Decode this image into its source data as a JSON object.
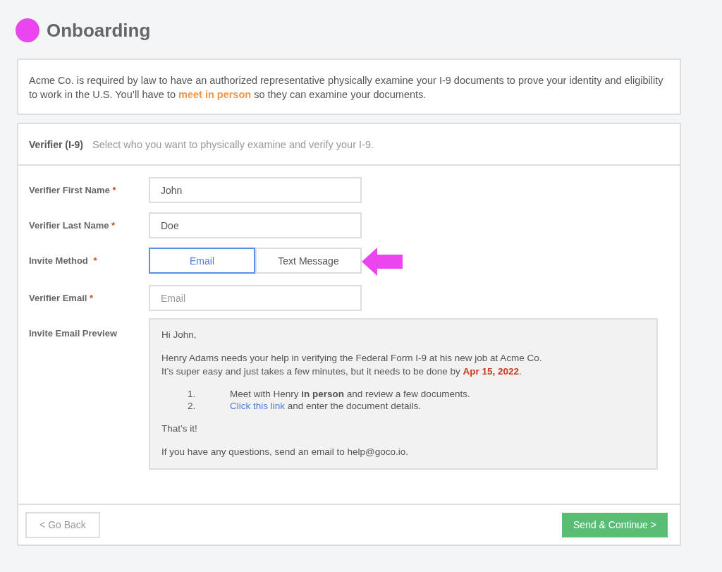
{
  "header": {
    "title": "Onboarding"
  },
  "notice": {
    "text": "Acme Co. is required by law to have an authorized representative physically examine your I-9 documents to prove your identity and eligibility to work in the U.S. You’ll have to **meet in person** so they can examine your documents."
  },
  "section": {
    "title": "Verifier (I-9)",
    "subtitle": "Select who you want to physically examine and verify your I-9."
  },
  "fields": [
    {
      "kind": "text",
      "label": "Verifier First Name",
      "required_mark": "*",
      "value": "John"
    },
    {
      "kind": "text",
      "label": "Verifier Last Name",
      "required_mark": "*",
      "value": "Doe"
    },
    {
      "kind": "segmented",
      "label": "Invite Method",
      "required_mark": "*",
      "options": [
        {
          "label": "Email",
          "selected": true
        },
        {
          "label": "Text Message",
          "selected": false
        }
      ]
    },
    {
      "kind": "text",
      "label": "Verifier Email",
      "required_mark": "*",
      "placeholder": "Email"
    },
    {
      "kind": "preview",
      "label": "Invite Email Preview",
      "greeting": "Hi John,",
      "body_lines": [
        "Henry Adams needs your help in verifying the Federal Form I-9 at his new job at Acme Co.",
        "It’s super easy and just takes a few minutes, but it needs to be done by **Apr 15, 2022**."
      ],
      "steps": [
        {
          "number": "1.",
          "text": "Meet with Henry **in person** and review a few documents."
        },
        {
          "number": "2.",
          "link": "Click this link",
          "text": "and enter the document details."
        }
      ],
      "closing": "That’s it!",
      "footer": "If you have any questions, send an email to help@goco.io."
    }
  ],
  "buttons": {
    "back": "< Go Back",
    "next": "Send & Continue >"
  }
}
